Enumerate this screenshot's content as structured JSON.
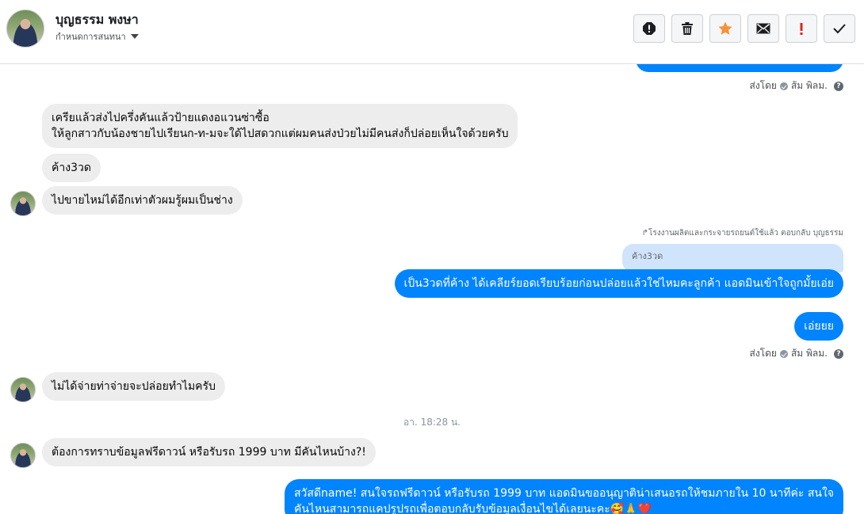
{
  "header": {
    "contact_name": "บุญธรรม พงษา",
    "assign_label": "กำหนดการสนทนา",
    "actions": [
      {
        "name": "spam-icon",
        "label": "Report"
      },
      {
        "name": "trash-icon",
        "label": "Delete"
      },
      {
        "name": "star-icon",
        "label": "Star"
      },
      {
        "name": "envelope-icon",
        "label": "Mark unread"
      },
      {
        "name": "follow-up-icon",
        "label": "Follow up"
      },
      {
        "name": "check-icon",
        "label": "Done"
      }
    ],
    "colors": {
      "star": "#f7923a",
      "follow_up": "#e02424"
    }
  },
  "messages": {
    "sent_by_1": "ส่งโดย",
    "agent_1": "ส้ม พิลม.",
    "in_1_line1": "เครียแล้วส่งไปครึ่งคันแล้วป้ายแดงอแวนซ่าซื้อ",
    "in_1_line2": "ให้ลูกสาวกับน้องชายไปเรียนก-ท-มจะใด้ไปสดวกแต่ผมคนส่งป่วยไม่มีคนส่งก็ปล่อยเห็นใจด้วยครับ",
    "in_2": "ค้าง3วด",
    "in_3": "ไปขายไหม่ได้อีกเท่าตัวผมรู้ผมเป็นช่าง",
    "reply_note": "โรงงานผลิตและกระจายรถยนต์ใช้แล้ว ตอบกลับ บุญธรรม",
    "quoted": "ค้าง3วด",
    "out_1": "เป็น3วดที่ค้าง ได้เคลียร์ยอดเรียบร้อยก่อนปล่อยแล้วใช่ไหมคะลูกค้า แอดมินเข้าใจถูกมั้ยเอ่ย",
    "out_2": "เอ่ยยย",
    "sent_by_2": "ส่งโดย",
    "agent_2": "ส้ม พิลม.",
    "in_4": "ไม่ได้จ่ายท่าจ่ายจะปล่อยทำไมครับ",
    "timestamp": "อา. 18:28 น.",
    "in_5": "ต้องการทราบข้อมูลฟรีดาวน์ หรือรับรถ 1999 บาท มีคันไหนบ้าง?!",
    "out_3_line1": "สวัสดีname! สนใจรถฟรีดาวน์ หรือรับรถ 1999 บาท แอดมินขออนุญาติน่าเสนอรถให้ชมภายใน 10 นาทีค่ะ สนใจ",
    "out_3_line2": "คันไหนสามารถแคปรูปรถเพื่อตอบกลับรับข้อมูลเงื่อนไขได้เลยนะคะ🥰🙏❤️"
  }
}
